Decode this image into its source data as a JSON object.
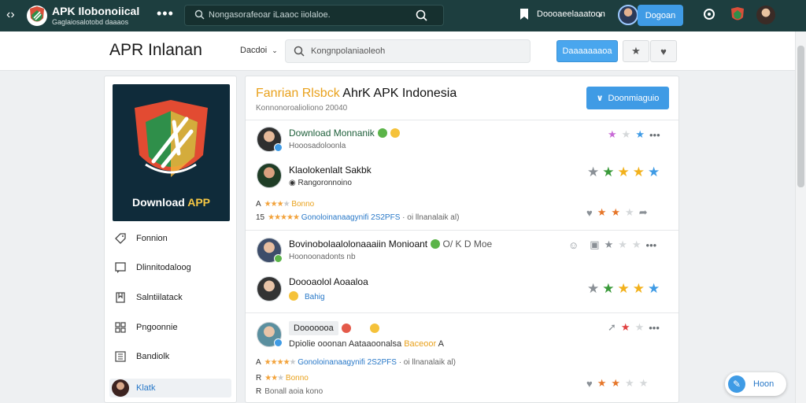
{
  "header": {
    "brand_title": "APK Ilobonoiical",
    "brand_subtitle": "Gaglaiosalotobd daaaos",
    "search_placeholder": "Nongasorafeoar iLaaoc iiolaloe.",
    "nav_label": "Doooaeelaaatoon",
    "login_label": "Dogoan"
  },
  "subheader": {
    "page_title": "APR Inlanan",
    "sort_label": "Dacdoi",
    "search_placeholder": "Kongnpolaniaoleoh",
    "download_label": "Daaaaaaaoa"
  },
  "sidebar": {
    "promo_label_main": "Download ",
    "promo_label_accent": "APP",
    "items": [
      {
        "label": "Fonnion",
        "icon": "tag-icon"
      },
      {
        "label": "Dlinnitodaloog",
        "icon": "comment-icon"
      },
      {
        "label": "Salntiilatack",
        "icon": "bookmark-icon"
      },
      {
        "label": "Pngoonnie",
        "icon": "grid-icon"
      },
      {
        "label": "Bandiolk",
        "icon": "list-icon"
      },
      {
        "label": "Klatk",
        "icon": "user-avatar"
      }
    ]
  },
  "main": {
    "title_accent": "Fanrian Rlsbck",
    "title_rest": " AhrK APK Indonesia",
    "subtitle": "Konnonoroalioliono 20040",
    "download_button": "Doonmiaguio",
    "rows": [
      {
        "name": "Download Monnanik",
        "meta": "Hooosadoloonla"
      },
      {
        "name": "Klaolokenlalt Sakbk",
        "tag": "Rangoronnoino",
        "num": "15",
        "line_orange": "Bonno",
        "line_blue": "Gonoloinanaagynifi 2S2PFS",
        "line_grey": "· oi llnanalaik al)"
      },
      {
        "name": "Bovinobolaalolonaaaiin Monioant",
        "extra": "O/ K D Moe",
        "meta": "Hoonoonadonts nb"
      },
      {
        "name": "Doooaolol Aoaaloa",
        "tag": "Bahig"
      },
      {
        "name": "Dooooooa",
        "line1_dark": "Dpiolie ooonan Aataaoonalsa",
        "line1_orange": "Baceoor",
        "line1_tail": "A",
        "num2": "A",
        "line2_blue": "Gonoloinanaagynifi 2S2PFS",
        "line2_grey": "· oi llnanalaik al)",
        "num3": "R",
        "line3_orange": "Bonno",
        "num4": "R",
        "line4_grey": "Bonall aoia kono"
      }
    ]
  },
  "fab": {
    "label": "Hoon"
  },
  "colors": {
    "topbar": "#1d3e3f",
    "accent_blue": "#3f9be5",
    "accent_orange": "#e9a11c",
    "accent_green": "#3a9a3a"
  }
}
